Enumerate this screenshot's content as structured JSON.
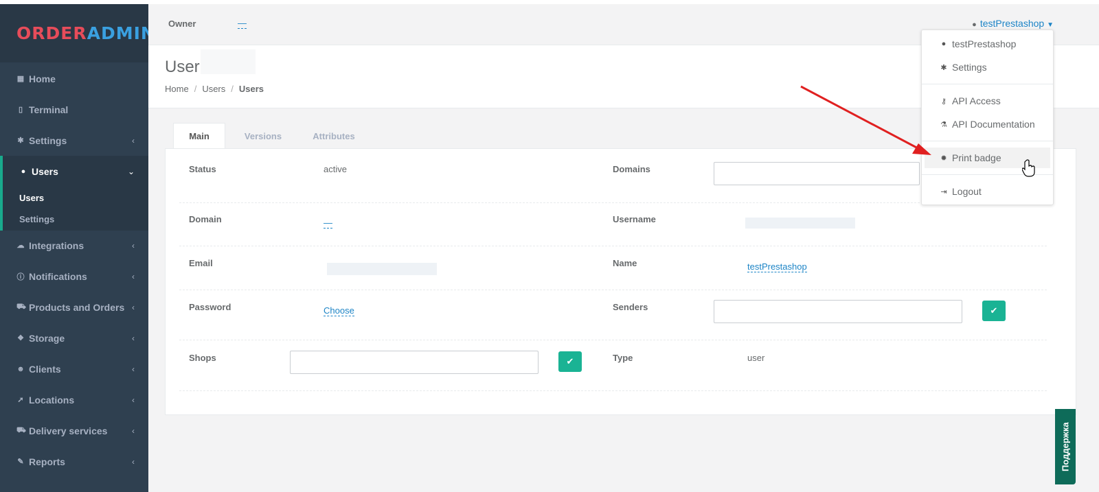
{
  "brand": {
    "part1": "ORDER",
    "part2": "ADMIN"
  },
  "sidebar": {
    "items": [
      {
        "label": "Home",
        "icon": "grid-icon"
      },
      {
        "label": "Terminal",
        "icon": "tablet-icon"
      },
      {
        "label": "Settings",
        "icon": "gear-icon"
      },
      {
        "label": "Users",
        "icon": "user-icon"
      },
      {
        "label": "Integrations",
        "icon": "cloud-icon"
      },
      {
        "label": "Notifications",
        "icon": "info-icon"
      },
      {
        "label": "Products and Orders",
        "icon": "cart-icon"
      },
      {
        "label": "Storage",
        "icon": "cubes-icon"
      },
      {
        "label": "Clients",
        "icon": "users-icon"
      },
      {
        "label": "Locations",
        "icon": "location-arrow-icon"
      },
      {
        "label": "Delivery services",
        "icon": "truck-icon"
      },
      {
        "label": "Reports",
        "icon": "paperclip-icon"
      }
    ],
    "users_submenu": [
      "Users",
      "Settings"
    ]
  },
  "topbar": {
    "owner_label": "Owner",
    "owner_value": "—",
    "username": "testPrestashop"
  },
  "page": {
    "title": "User"
  },
  "breadcrumb": [
    "Home",
    "Users",
    "Users"
  ],
  "tabs": [
    "Main",
    "Versions",
    "Attributes"
  ],
  "fields": {
    "status_label": "Status",
    "status_value": "active",
    "domains_label": "Domains",
    "domain_label": "Domain",
    "domain_value": "—",
    "username_label": "Username",
    "email_label": "Email",
    "name_label": "Name",
    "name_value": "testPrestashop",
    "password_label": "Password",
    "password_value": "Choose",
    "senders_label": "Senders",
    "shops_label": "Shops",
    "type_label": "Type",
    "type_value": "user"
  },
  "dropdown": {
    "items": [
      {
        "label": "testPrestashop",
        "icon": "user-icon"
      },
      {
        "label": "Settings",
        "icon": "gear-icon"
      },
      {
        "label": "API Access",
        "icon": "key-icon"
      },
      {
        "label": "API Documentation",
        "icon": "flask-icon"
      },
      {
        "label": "Print badge",
        "icon": "certificate-icon"
      },
      {
        "label": "Logout",
        "icon": "sign-out-icon"
      }
    ]
  },
  "support_label": "Поддержка",
  "colors": {
    "sidebar": "#2f4050",
    "accent": "#19aa8d",
    "link": "#1c84c6",
    "arrow": "#e02020"
  }
}
